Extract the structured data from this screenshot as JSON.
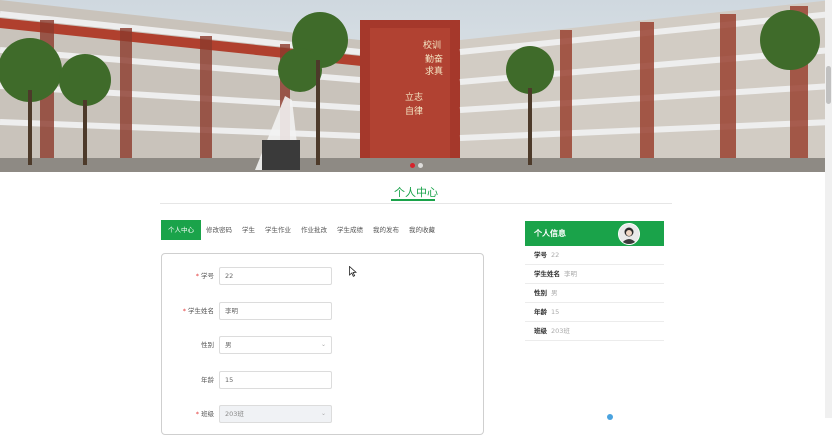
{
  "page_title": "个人中心",
  "tabs": [
    {
      "label": "个人中心",
      "active": true
    },
    {
      "label": "修改密码"
    },
    {
      "label": "学生"
    },
    {
      "label": "学生作业"
    },
    {
      "label": "作业批改"
    },
    {
      "label": "学生成绩"
    },
    {
      "label": "我的发布"
    },
    {
      "label": "我的收藏"
    }
  ],
  "form": {
    "fields": [
      {
        "label": "学号",
        "required": true,
        "value": "22"
      },
      {
        "label": "学生姓名",
        "required": true,
        "value": "李明"
      },
      {
        "label": "性别",
        "required": false,
        "value": "男"
      },
      {
        "label": "年龄",
        "required": false,
        "value": "15"
      },
      {
        "label": "班级",
        "required": true,
        "value": "203班"
      }
    ],
    "required_mark": "*"
  },
  "info_panel": {
    "title": "个人信息",
    "rows": [
      {
        "key": "学号",
        "value": "22"
      },
      {
        "key": "学生姓名",
        "value": "李明"
      },
      {
        "key": "性别",
        "value": "男"
      },
      {
        "key": "年龄",
        "value": "15"
      },
      {
        "key": "班级",
        "value": "203班"
      }
    ]
  },
  "banner": {
    "sign_text_left": "校训",
    "sign_text_1": "勤奋",
    "sign_text_2": "求真",
    "sign_text_3": "立志",
    "sign_text_4": "自律"
  },
  "colors": {
    "accent": "#1aa34a",
    "required": "#e23b3b",
    "carousel_active": "#d6232c"
  }
}
